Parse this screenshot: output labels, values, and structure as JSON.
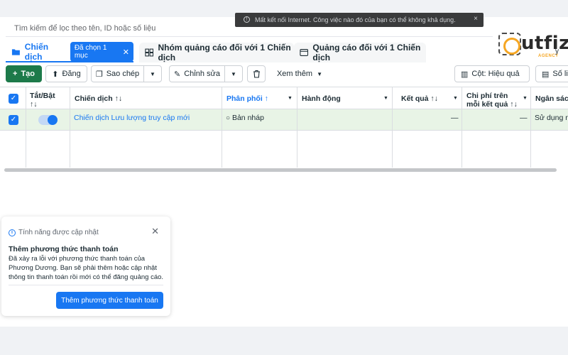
{
  "search": {
    "placeholder": "Tìm kiếm để lọc theo tên, ID hoặc số liệu"
  },
  "toast": {
    "text": "Mất kết nối Internet. Công việc nào đó của bạn có thể không khả dụng."
  },
  "logo": {
    "text": "utfiz",
    "sub": "AGENCY",
    "peek": "y"
  },
  "tabs": [
    {
      "label": "Chiến dịch",
      "chip": "Đã chọn 1 mục"
    },
    {
      "label": "Nhóm quảng cáo đối với 1 Chiến dịch"
    },
    {
      "label": "Quảng cáo đối với 1 Chiến dịch"
    }
  ],
  "toolbar": {
    "create": "Tạo",
    "upload": "Đăng",
    "duplicate": "Sao chép",
    "edit": "Chỉnh sửa",
    "see_more": "Xem thêm",
    "columns": "Cột: Hiệu quả",
    "breakdown": "Số liệu"
  },
  "table": {
    "headers": {
      "toggle": "Tắt/Bật",
      "campaign": "Chiến dịch",
      "delivery": "Phân phối",
      "actions": "Hành động",
      "results": "Kết quả",
      "cost_per_result": "Chi phí trên mỗi kết quả",
      "budget": "Ngân sách"
    },
    "row": {
      "campaign": "Chiến dịch Lưu lượng truy cập mới",
      "delivery": "Bản nháp",
      "results": "—",
      "cost_per_result": "—",
      "budget": "Sử dụng ng"
    }
  },
  "notice": {
    "header": "Tính năng được cập nhật",
    "title": "Thêm phương thức thanh toán",
    "body": "Đã xảy ra lỗi với phương thức thanh toán của Phương Dương. Bạn sẽ phải thêm hoặc cập nhật thông tin thanh toán rồi mới có thể đăng quảng cáo.",
    "cta": "Thêm phương thức thanh toán"
  },
  "colors": {
    "primary": "#1877f2",
    "create": "#1d7a4a",
    "selected_row": "#e8f4e6",
    "toast": "#3a3b3c",
    "logo_accent": "#f5a623"
  }
}
